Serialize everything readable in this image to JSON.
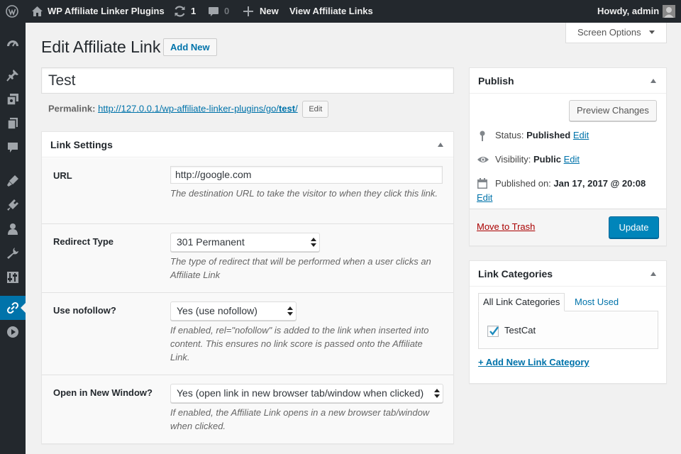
{
  "adminbar": {
    "site_name": "WP Affiliate Linker Plugins",
    "updates_count": "1",
    "comments_count": "0",
    "new_label": "New",
    "view_label": "View Affiliate Links",
    "howdy": "Howdy, admin"
  },
  "sidemenu": [
    "dashboard-icon",
    "pin-icon",
    "media-icon",
    "pages-icon",
    "comments-icon",
    "appearance-icon",
    "plugins-icon",
    "users-icon",
    "tools-icon",
    "settings-icon",
    "affiliate-link-icon",
    "play-icon"
  ],
  "screen_options": "Screen Options",
  "page": {
    "title": "Edit Affiliate Link",
    "add_new": "Add New",
    "post_title": "Test",
    "permalink_label": "Permalink:",
    "permalink_url": "http://127.0.0.1/wp-affiliate-linker-plugins/go/",
    "permalink_slug": "test",
    "permalink_trailing": "/",
    "permalink_edit": "Edit"
  },
  "link_settings": {
    "title": "Link Settings",
    "rows": {
      "url": {
        "label": "URL",
        "value": "http://google.com",
        "desc": "The destination URL to take the visitor to when they click this link."
      },
      "redirect": {
        "label": "Redirect Type",
        "value": "301 Permanent",
        "desc": "The type of redirect that will be performed when a user clicks an Affiliate Link"
      },
      "nofollow": {
        "label": "Use nofollow?",
        "value": "Yes (use nofollow)",
        "desc": "If enabled, rel=\"nofollow\" is added to the link when inserted into content. This ensures no link score is passed onto the Affiliate Link."
      },
      "newwindow": {
        "label": "Open in New Window?",
        "value": "Yes (open link in new browser tab/window when clicked)",
        "desc": "If enabled, the Affiliate Link opens in a new browser tab/window when clicked."
      }
    }
  },
  "publish": {
    "title": "Publish",
    "preview": "Preview Changes",
    "status_label": "Status:",
    "status_value": "Published",
    "visibility_label": "Visibility:",
    "visibility_value": "Public",
    "published_label": "Published on:",
    "published_value": "Jan 17, 2017 @ 20:08",
    "edit": "Edit",
    "trash": "Move to Trash",
    "update": "Update"
  },
  "categories": {
    "title": "Link Categories",
    "tab_all": "All Link Categories",
    "tab_most_used": "Most Used",
    "items": [
      {
        "name": "TestCat",
        "checked": true
      }
    ],
    "add_new": "+ Add New Link Category"
  },
  "colors": {
    "accent": "#0073aa",
    "adminbar": "#23282d",
    "primary_button": "#0085ba",
    "danger": "#a00"
  }
}
